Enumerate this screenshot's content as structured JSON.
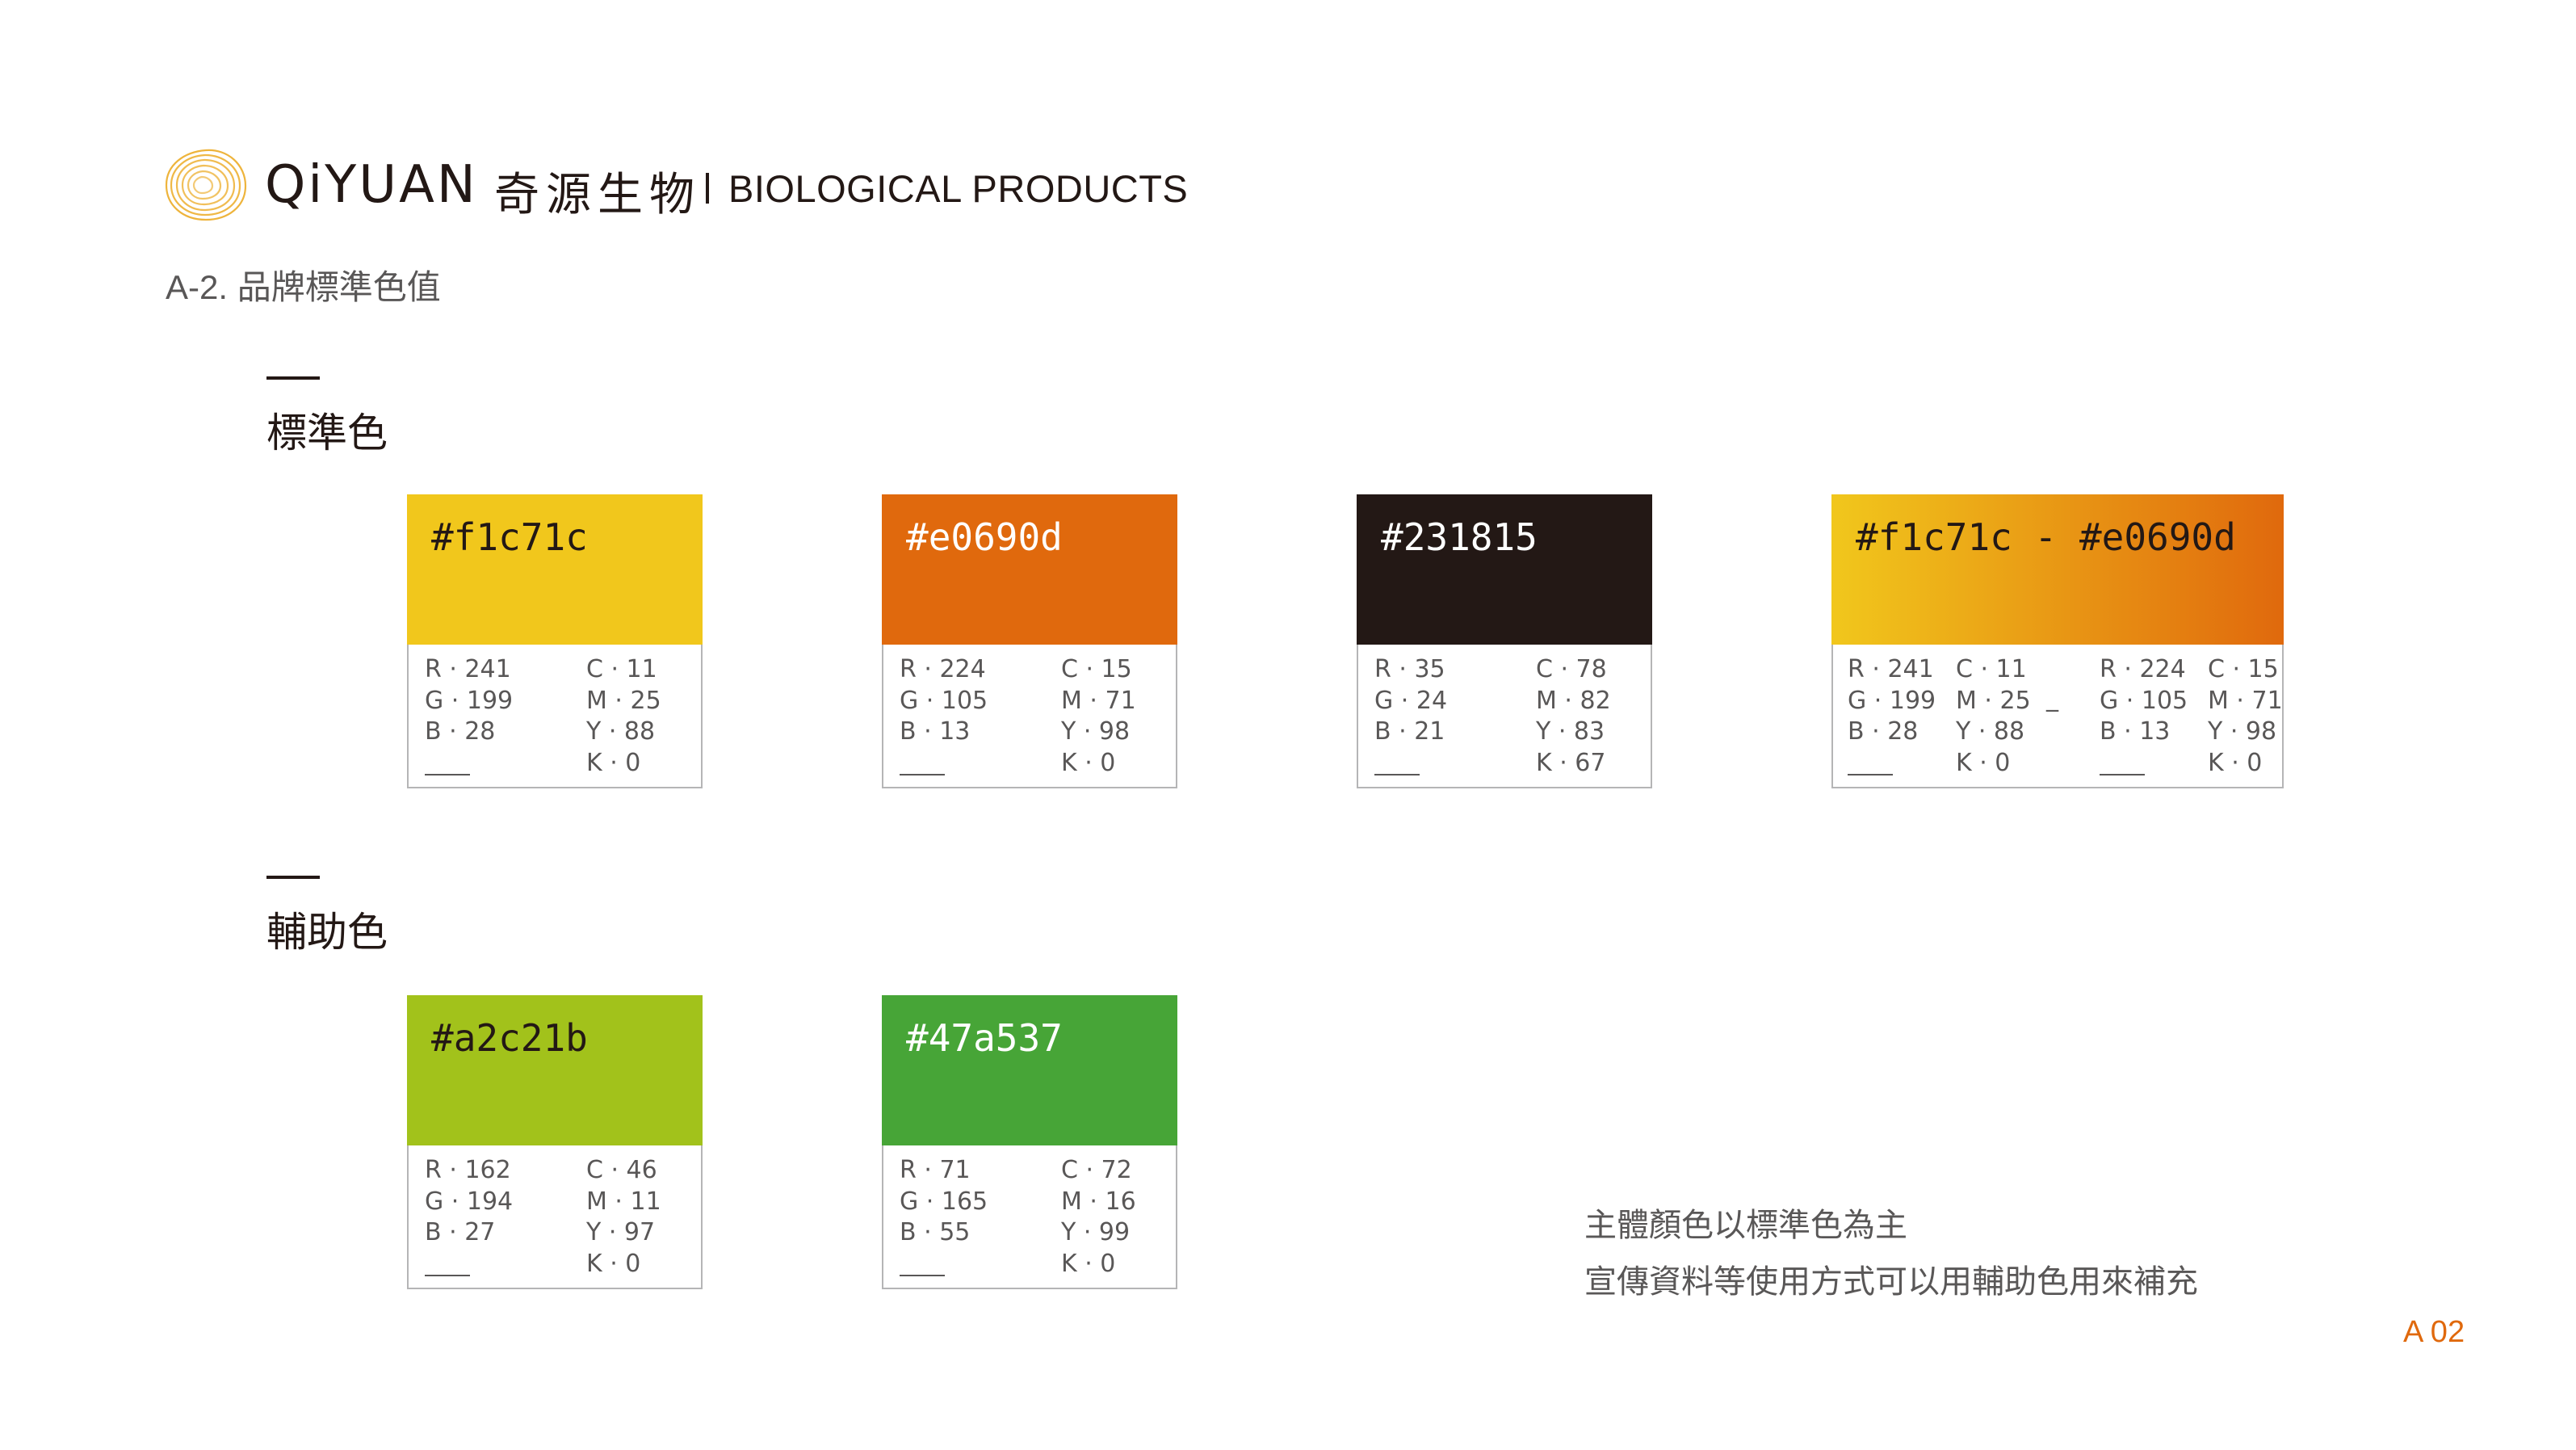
{
  "header": {
    "brand_wordmark": "QiYUAN",
    "brand_chinese": "奇源生物",
    "brand_english": "BIOLOGICAL PRODUCTS",
    "section_title": "A-2. 品牌標準色值"
  },
  "groups": {
    "standard": {
      "title": "標準色",
      "swatches": [
        {
          "hex": "#f1c71c",
          "r": "R · 241",
          "g": "G · 199",
          "b": "B · 28",
          "c": "C · 11",
          "m": "M · 25",
          "y": "Y · 88",
          "k": "K · 0"
        },
        {
          "hex": "#e0690d",
          "r": "R · 224",
          "g": "G · 105",
          "b": "B · 13",
          "c": "C · 15",
          "m": "M · 71",
          "y": "Y · 98",
          "k": "K · 0"
        },
        {
          "hex": "#231815",
          "r": "R · 35",
          "g": "G · 24",
          "b": "B · 21",
          "c": "C · 78",
          "m": "M · 82",
          "y": "Y · 83",
          "k": "K · 67"
        }
      ],
      "gradient": {
        "label": "#f1c71c - #e0690d",
        "color_from": "#f1c71c",
        "color_to": "#e0690d",
        "separator": "_",
        "from": {
          "r": "R · 241",
          "g": "G · 199",
          "b": "B · 28",
          "c": "C · 11",
          "m": "M · 25",
          "y": "Y · 88",
          "k": "K · 0"
        },
        "to": {
          "r": "R · 224",
          "g": "G · 105",
          "b": "B · 13",
          "c": "C · 15",
          "m": "M · 71",
          "y": "Y · 98",
          "k": "K · 0"
        }
      }
    },
    "auxiliary": {
      "title": "輔助色",
      "swatches": [
        {
          "hex": "#a2c21b",
          "r": "R · 162",
          "g": "G · 194",
          "b": "B · 27",
          "c": "C · 46",
          "m": "M · 11",
          "y": "Y · 97",
          "k": "K · 0"
        },
        {
          "hex": "#47a537",
          "r": "R · 71",
          "g": "G · 165",
          "b": "B · 55",
          "c": "C · 72",
          "m": "M · 16",
          "y": "Y · 99",
          "k": "K · 0"
        }
      ]
    }
  },
  "notes": {
    "line1": "主體顏色以標準色為主",
    "line2": "宣傳資料等使用方式可以用輔助色用來補充"
  },
  "page_number": "A 02",
  "colors": {
    "text": "#231815",
    "grey_text": "#595757",
    "border": "#b5b5b6",
    "accent": "#e0690d",
    "logo_gold": "#eeb43c"
  }
}
